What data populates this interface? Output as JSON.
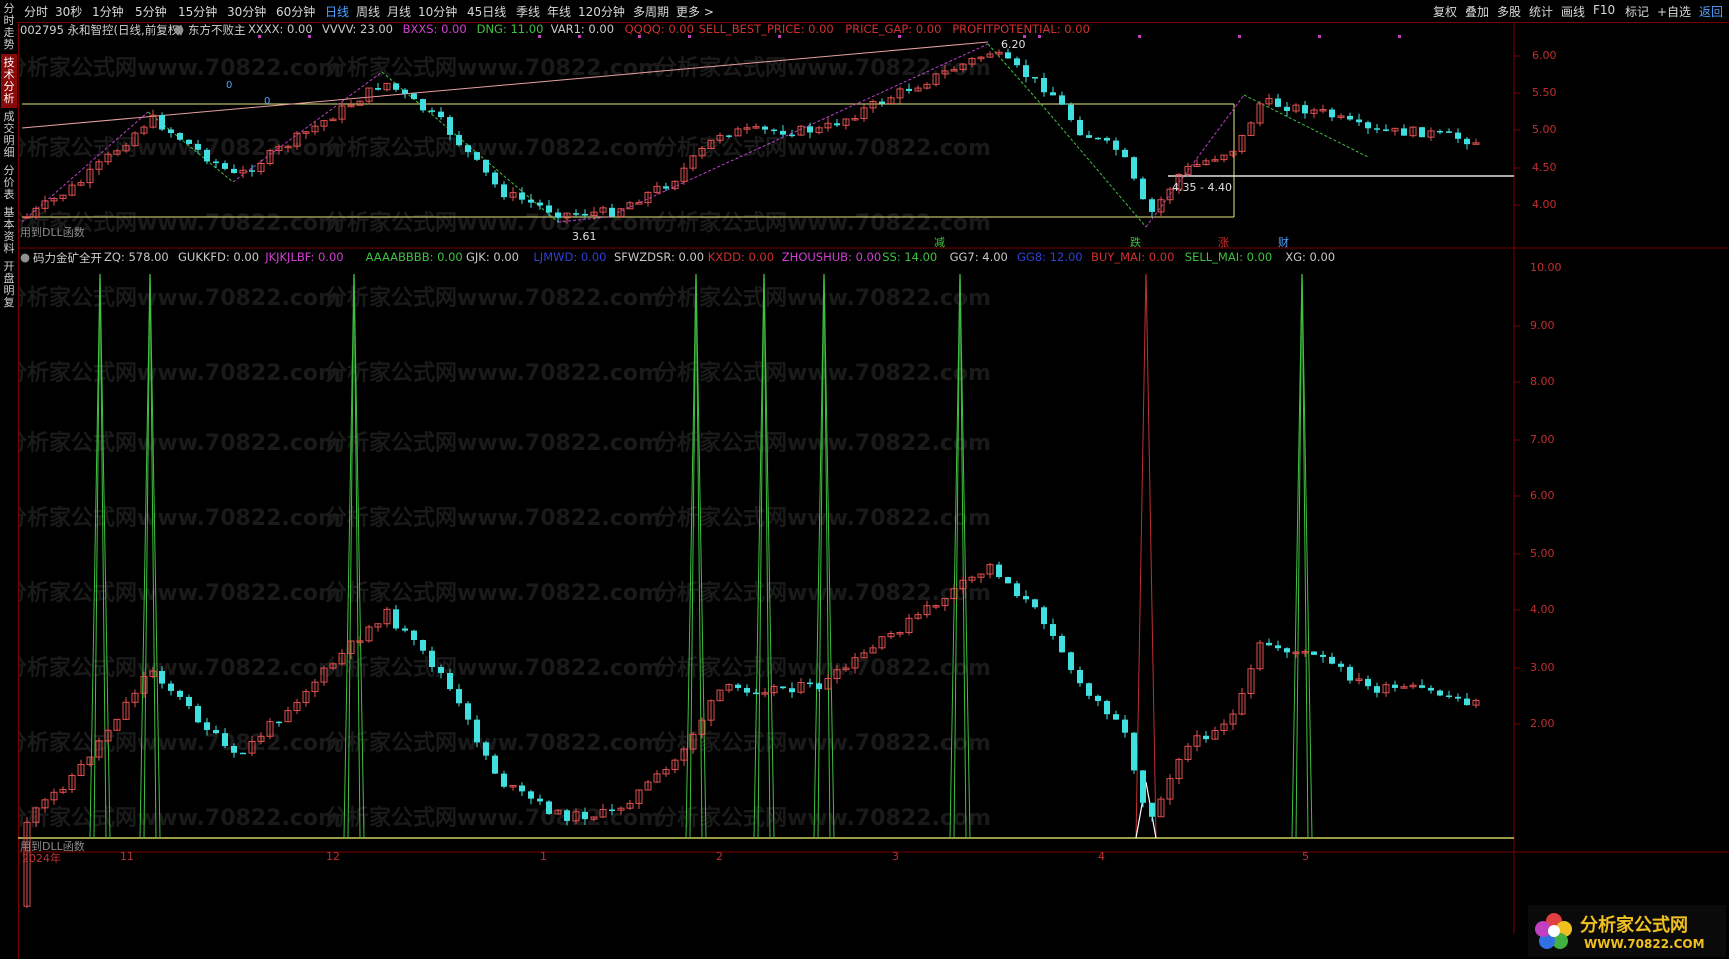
{
  "sidebar": {
    "tabs": [
      {
        "label": "分时走势",
        "active": false
      },
      {
        "label": "技术分析",
        "active": true
      },
      {
        "label": "成交明细",
        "active": false
      },
      {
        "label": "分价表",
        "active": false
      },
      {
        "label": "基本资料",
        "active": false
      },
      {
        "label": "开盘明复",
        "active": false
      }
    ]
  },
  "toolbar": {
    "periods": [
      "分时",
      "30秒",
      "1分钟",
      "5分钟",
      "15分钟",
      "30分钟",
      "60分钟",
      "日线",
      "周线",
      "月线",
      "10分钟",
      "45日线",
      "季线",
      "年线",
      "120分钟",
      "多周期",
      "更多 >"
    ],
    "active_period": "日线",
    "tools": [
      "复权",
      "叠加",
      "多股",
      "统计",
      "画线",
      "F10",
      "标记",
      "+自选",
      "返回"
    ]
  },
  "main_legend": {
    "title": "002795 永和智控(日线,前复权)",
    "indicator": "东方不败主",
    "items": [
      {
        "text": "XXXX: 0.00",
        "color": "#c8c8c8"
      },
      {
        "text": "VVVV: 23.00",
        "color": "#c8c8c8"
      },
      {
        "text": "BXXS: 0.00",
        "color": "#d040d0"
      },
      {
        "text": "DNG: 11.00",
        "color": "#40c040"
      },
      {
        "text": "VAR1: 0.00",
        "color": "#c8c8c8"
      },
      {
        "text": "QQQQ: 0.00",
        "color": "#d03030"
      },
      {
        "text": "SELL_BEST_PRICE: 0.00",
        "color": "#d03030"
      },
      {
        "text": "PRICE_GAP: 0.00",
        "color": "#d03030"
      },
      {
        "text": "PROFITPOTENTIAL: 0.00",
        "color": "#d03030"
      }
    ]
  },
  "ind_legend": {
    "title": "码力金矿全开",
    "items": [
      {
        "text": "ZQ: 578.00",
        "color": "#c8c8c8"
      },
      {
        "text": "GUKKFD: 0.00",
        "color": "#c8c8c8"
      },
      {
        "text": "JKJKJLBF: 0.00",
        "color": "#d040d0"
      },
      {
        "text": "AAAABBBB: 0.00",
        "color": "#40c040"
      },
      {
        "text": "GJK: 0.00",
        "color": "#c8c8c8"
      },
      {
        "text": "LJMWD: 0.00",
        "color": "#3040d0"
      },
      {
        "text": "SFWZDSR: 0.00",
        "color": "#c8c8c8"
      },
      {
        "text": "KXDD: 0.00",
        "color": "#d03030"
      },
      {
        "text": "ZHOUSHUB: 0.00",
        "color": "#d040d0"
      },
      {
        "text": "SS: 14.00",
        "color": "#40c040"
      },
      {
        "text": "GG7: 4.00",
        "color": "#c8c8c8"
      },
      {
        "text": "GG8: 12.00",
        "color": "#3040d0"
      },
      {
        "text": "BUY_MAI: 0.00",
        "color": "#d03030"
      },
      {
        "text": "SELL_MAI: 0.00",
        "color": "#40c040"
      },
      {
        "text": "XG: 0.00",
        "color": "#c8c8c8"
      }
    ]
  },
  "main_axis": [
    "6.00",
    "5.50",
    "5.00",
    "4.50",
    "4.00"
  ],
  "ind_axis": [
    "10.00",
    "9.00",
    "8.00",
    "7.00",
    "6.00",
    "5.00",
    "4.00",
    "3.00",
    "2.00"
  ],
  "annotations": {
    "high": "6.20",
    "low": "3.61",
    "range": "4.35 - 4.40",
    "zero_a": "0",
    "zero_b": "0",
    "dll_note_main": "用到DLL函数",
    "dll_note_ind": "用到DLL函数"
  },
  "badges": [
    {
      "text": "减",
      "color": "#40c040"
    },
    {
      "text": "跌",
      "color": "#40c040"
    },
    {
      "text": "涨",
      "color": "#d03030"
    },
    {
      "text": "财",
      "color": "#4fa3ff"
    }
  ],
  "dates": [
    "2024年",
    "11",
    "12",
    "1",
    "2",
    "3",
    "4",
    "5"
  ],
  "watermark": "分析家公式网www.70822.com",
  "logo": {
    "title": "分析家公式网",
    "url": "WWW.70822.COM"
  },
  "colors": {
    "up": "#e05050",
    "down": "#40e0e0",
    "accent": "#4fa3ff",
    "frame": "#7a0000"
  }
}
